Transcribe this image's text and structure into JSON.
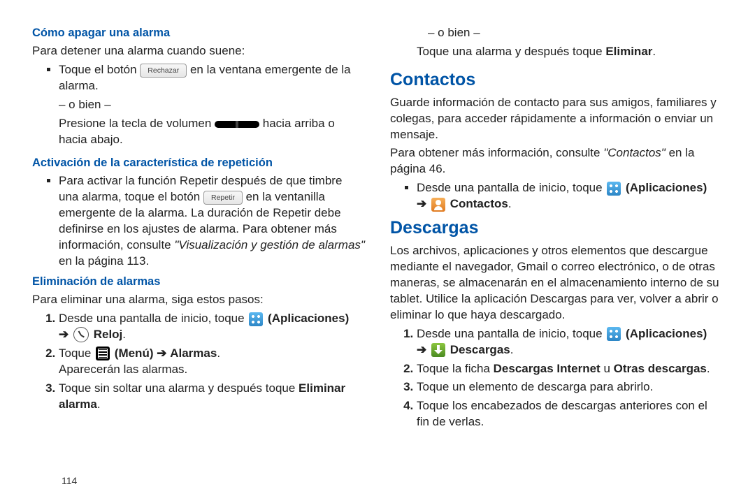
{
  "pageNumber": "114",
  "left": {
    "h1": "Cómo apagar una alarma",
    "p1": "Para detener una alarma cuando suene:",
    "b1_pre": "Toque el botón ",
    "b1_chip": "Rechazar",
    "b1_post": " en la ventana emergente de la alarma.",
    "or": "– o bien –",
    "b1b_pre": "Presione la tecla de volumen ",
    "b1b_post": " hacia arriba o hacia abajo.",
    "h2": "Activación de la característica de repetición",
    "b2_pre": "Para activar la función Repetir después de que timbre una alarma, toque el botón ",
    "b2_chip": "Repetir",
    "b2_mid": " en la ventanilla emergente de la alarma. La duración de Repetir debe definirse en los ajustes de alarma. Para obtener más información, consulte ",
    "b2_ref": "\"Visualización y gestión de alarmas\"",
    "b2_post": " en la página 113.",
    "h3": "Eliminación de alarmas",
    "p3": "Para eliminar una alarma, siga estos pasos:",
    "s1_pre": "Desde una pantalla de inicio, toque ",
    "s1_apps": "(Aplicaciones)",
    "s1_arrow": "➔",
    "s1_clock": "Reloj",
    "s2_pre": "Toque ",
    "s2_menu": "(Menú)",
    "s2_arrow": "➔",
    "s2_alarmas": "Alarmas",
    "s2_post": "Aparecerán las alarmas.",
    "s3_pre": "Toque sin soltar una alarma y después toque ",
    "s3_del": "Eliminar alarma"
  },
  "right": {
    "or": "– o bien –",
    "p_top_pre": "Toque una alarma y después toque ",
    "p_top_bold": "Eliminar",
    "h_contact": "Contactos",
    "p_contact1": "Guarde información de contacto para sus amigos, familiares y colegas, para acceder rápidamente a información o enviar un mensaje.",
    "p_contact2_pre": "Para obtener más información, consulte ",
    "p_contact2_ref": "\"Contactos\"",
    "p_contact2_post": " en la página 46.",
    "cb_pre": "Desde una pantalla de inicio, toque ",
    "cb_apps": "(Aplicaciones)",
    "cb_arrow": "➔",
    "cb_contacts": "Contactos",
    "h_down": "Descargas",
    "p_down1": "Los archivos, aplicaciones y otros elementos que descargue mediante el navegador, Gmail o correo electrónico, o de otras maneras, se almacenarán en el almacenamiento interno de su tablet. Utilice la aplicación Descargas para ver, volver a abrir o eliminar lo que haya descargado.",
    "d1_pre": "Desde una pantalla de inicio, toque ",
    "d1_apps": "(Aplicaciones)",
    "d1_arrow": "➔",
    "d1_down": "Descargas",
    "d2_pre": "Toque la ficha ",
    "d2_b1": "Descargas Internet",
    "d2_mid": " u ",
    "d2_b2": "Otras descargas",
    "d3": "Toque un elemento de descarga para abrirlo.",
    "d4": "Toque los encabezados de descargas anteriores con el fin de verlas."
  }
}
